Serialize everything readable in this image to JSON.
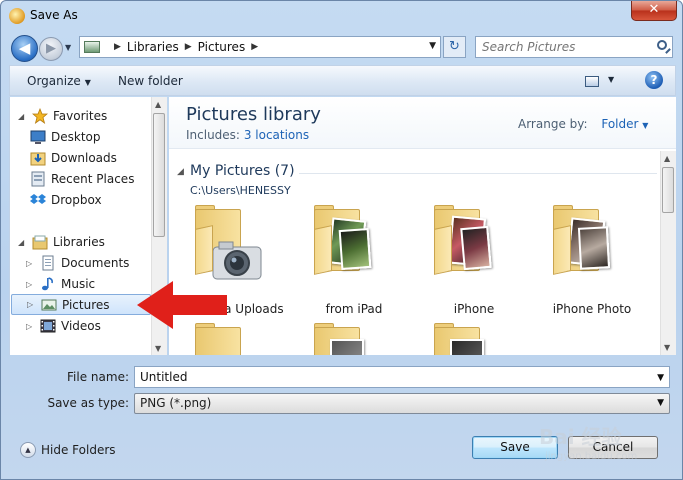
{
  "window": {
    "title": "Save As",
    "close_glyph": "✕"
  },
  "nav": {
    "back_glyph": "◀",
    "forward_glyph": "▶",
    "breadcrumb": [
      "Libraries",
      "Pictures"
    ],
    "refresh_glyph": "↻",
    "search_placeholder": "Search Pictures"
  },
  "toolbar": {
    "organize": "Organize",
    "new_folder": "New folder",
    "help_glyph": "?"
  },
  "sidebar": {
    "favorites_header": "Favorites",
    "favorites": [
      "Desktop",
      "Downloads",
      "Recent Places",
      "Dropbox"
    ],
    "libraries_header": "Libraries",
    "libraries": [
      "Documents",
      "Music",
      "Pictures",
      "Videos"
    ],
    "selected": "Pictures"
  },
  "main": {
    "library_title": "Pictures library",
    "includes_label": "Includes:",
    "includes_link": "3 locations",
    "arrange_label": "Arrange by:",
    "arrange_value": "Folder",
    "group_title": "My Pictures (7)",
    "group_path": "C:\\Users\\HENESSY",
    "folders": [
      "Camera Uploads",
      "from iPad",
      "iPhone",
      "iPhone Photo"
    ]
  },
  "form": {
    "file_name_label": "File name:",
    "file_name_value": "Untitled",
    "save_type_label": "Save as type:",
    "save_type_value": "PNG (*.png)"
  },
  "footer": {
    "hide_folders": "Hide Folders",
    "save": "Save",
    "cancel": "Cancel"
  },
  "overlay": {
    "watermark_text": "Bai 经验",
    "watermark_sub": "jingyan.baidu.com"
  },
  "colors": {
    "accent": "#1d63b6",
    "arrow_red": "#e0201a",
    "library_title": "#1e395b"
  }
}
